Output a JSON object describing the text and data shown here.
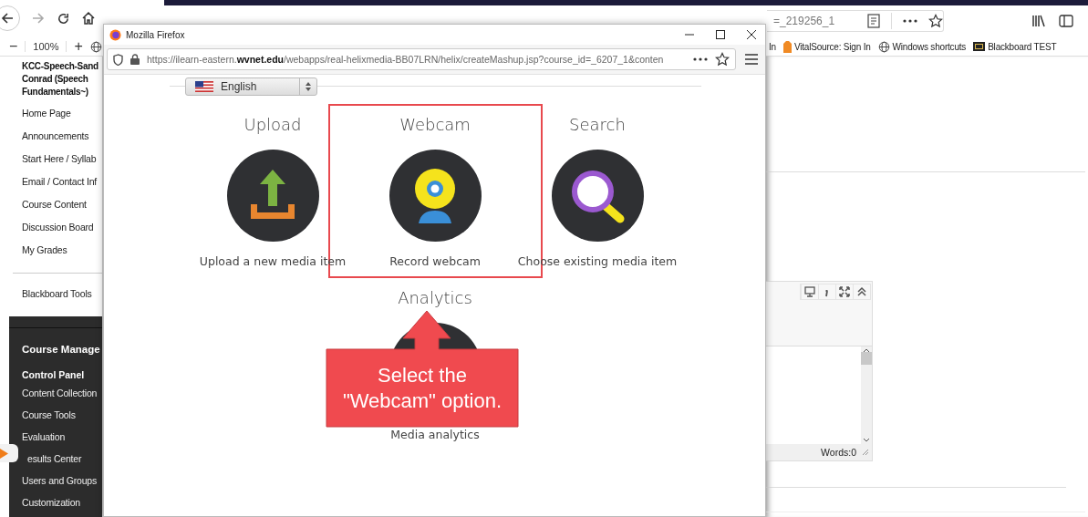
{
  "browser": {
    "address_tail": "=_219256_1",
    "zoom_out": "−",
    "zoom_level": "100%",
    "zoom_in": "+",
    "bookmarks": [
      {
        "kind": "text",
        "label": "In"
      },
      {
        "kind": "tag",
        "label": "VitalSource: Sign In"
      },
      {
        "kind": "globe",
        "label": "Windows shortcuts"
      },
      {
        "kind": "board",
        "label": "Blackboard TEST"
      }
    ]
  },
  "sidebar": {
    "course_title": "KCC-Speech-Sand Conrad (Speech Fundamentals~)",
    "items": [
      "Home Page",
      "Announcements",
      "Start Here / Syllab",
      "Email / Contact Inf",
      "Course Content",
      "Discussion Board",
      "My Grades"
    ],
    "tools": "Blackboard Tools",
    "management_heading": "Course Manage",
    "control_panel": "Control Panel",
    "panel_items": [
      "Content Collection",
      "Course Tools",
      "Evaluation",
      "esults Center",
      "Users and Groups",
      "Customization"
    ]
  },
  "editor": {
    "word_count": "Words:0"
  },
  "popup": {
    "title": "Mozilla Firefox",
    "url": "https://ilearn-eastern.**wvnet.edu**/webapps/real-helixmedia-BB07LRN/helix/createMashup.jsp?course_id=_6207_1&conten",
    "language": "English",
    "options": [
      {
        "kind": "upload",
        "title": "Upload",
        "caption": "Upload a new media item",
        "selected": false
      },
      {
        "kind": "webcam",
        "title": "Webcam",
        "caption": "Record webcam",
        "selected": true
      },
      {
        "kind": "search",
        "title": "Search",
        "caption": "Choose existing media item",
        "selected": false
      },
      {
        "kind": "analytics",
        "title": "Analytics",
        "caption": "Media analytics",
        "selected": false
      }
    ]
  },
  "callout": {
    "text": "Select the \"Webcam\" option."
  }
}
